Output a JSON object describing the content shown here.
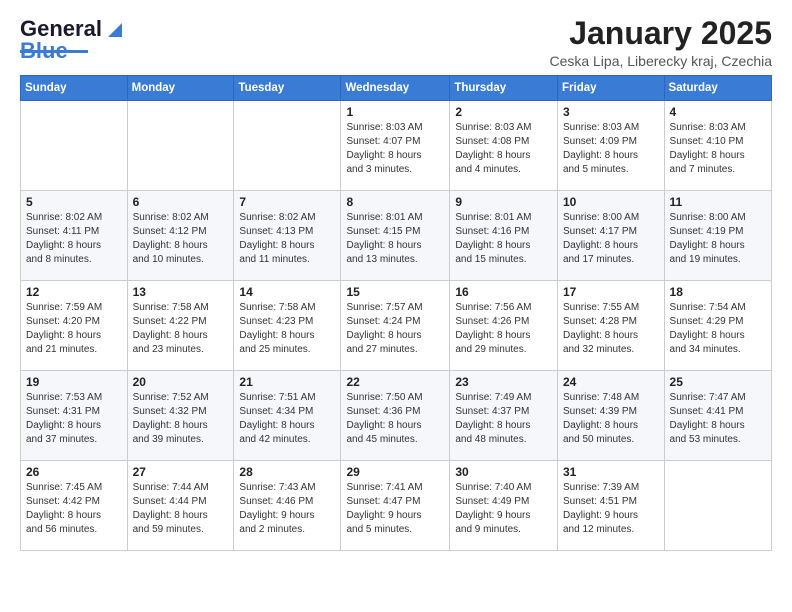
{
  "logo": {
    "text_general": "General",
    "text_blue": "Blue"
  },
  "header": {
    "title": "January 2025",
    "location": "Ceska Lipa, Liberecky kraj, Czechia"
  },
  "weekdays": [
    "Sunday",
    "Monday",
    "Tuesday",
    "Wednesday",
    "Thursday",
    "Friday",
    "Saturday"
  ],
  "weeks": [
    [
      {
        "day": "",
        "info": ""
      },
      {
        "day": "",
        "info": ""
      },
      {
        "day": "",
        "info": ""
      },
      {
        "day": "1",
        "info": "Sunrise: 8:03 AM\nSunset: 4:07 PM\nDaylight: 8 hours\nand 3 minutes."
      },
      {
        "day": "2",
        "info": "Sunrise: 8:03 AM\nSunset: 4:08 PM\nDaylight: 8 hours\nand 4 minutes."
      },
      {
        "day": "3",
        "info": "Sunrise: 8:03 AM\nSunset: 4:09 PM\nDaylight: 8 hours\nand 5 minutes."
      },
      {
        "day": "4",
        "info": "Sunrise: 8:03 AM\nSunset: 4:10 PM\nDaylight: 8 hours\nand 7 minutes."
      }
    ],
    [
      {
        "day": "5",
        "info": "Sunrise: 8:02 AM\nSunset: 4:11 PM\nDaylight: 8 hours\nand 8 minutes."
      },
      {
        "day": "6",
        "info": "Sunrise: 8:02 AM\nSunset: 4:12 PM\nDaylight: 8 hours\nand 10 minutes."
      },
      {
        "day": "7",
        "info": "Sunrise: 8:02 AM\nSunset: 4:13 PM\nDaylight: 8 hours\nand 11 minutes."
      },
      {
        "day": "8",
        "info": "Sunrise: 8:01 AM\nSunset: 4:15 PM\nDaylight: 8 hours\nand 13 minutes."
      },
      {
        "day": "9",
        "info": "Sunrise: 8:01 AM\nSunset: 4:16 PM\nDaylight: 8 hours\nand 15 minutes."
      },
      {
        "day": "10",
        "info": "Sunrise: 8:00 AM\nSunset: 4:17 PM\nDaylight: 8 hours\nand 17 minutes."
      },
      {
        "day": "11",
        "info": "Sunrise: 8:00 AM\nSunset: 4:19 PM\nDaylight: 8 hours\nand 19 minutes."
      }
    ],
    [
      {
        "day": "12",
        "info": "Sunrise: 7:59 AM\nSunset: 4:20 PM\nDaylight: 8 hours\nand 21 minutes."
      },
      {
        "day": "13",
        "info": "Sunrise: 7:58 AM\nSunset: 4:22 PM\nDaylight: 8 hours\nand 23 minutes."
      },
      {
        "day": "14",
        "info": "Sunrise: 7:58 AM\nSunset: 4:23 PM\nDaylight: 8 hours\nand 25 minutes."
      },
      {
        "day": "15",
        "info": "Sunrise: 7:57 AM\nSunset: 4:24 PM\nDaylight: 8 hours\nand 27 minutes."
      },
      {
        "day": "16",
        "info": "Sunrise: 7:56 AM\nSunset: 4:26 PM\nDaylight: 8 hours\nand 29 minutes."
      },
      {
        "day": "17",
        "info": "Sunrise: 7:55 AM\nSunset: 4:28 PM\nDaylight: 8 hours\nand 32 minutes."
      },
      {
        "day": "18",
        "info": "Sunrise: 7:54 AM\nSunset: 4:29 PM\nDaylight: 8 hours\nand 34 minutes."
      }
    ],
    [
      {
        "day": "19",
        "info": "Sunrise: 7:53 AM\nSunset: 4:31 PM\nDaylight: 8 hours\nand 37 minutes."
      },
      {
        "day": "20",
        "info": "Sunrise: 7:52 AM\nSunset: 4:32 PM\nDaylight: 8 hours\nand 39 minutes."
      },
      {
        "day": "21",
        "info": "Sunrise: 7:51 AM\nSunset: 4:34 PM\nDaylight: 8 hours\nand 42 minutes."
      },
      {
        "day": "22",
        "info": "Sunrise: 7:50 AM\nSunset: 4:36 PM\nDaylight: 8 hours\nand 45 minutes."
      },
      {
        "day": "23",
        "info": "Sunrise: 7:49 AM\nSunset: 4:37 PM\nDaylight: 8 hours\nand 48 minutes."
      },
      {
        "day": "24",
        "info": "Sunrise: 7:48 AM\nSunset: 4:39 PM\nDaylight: 8 hours\nand 50 minutes."
      },
      {
        "day": "25",
        "info": "Sunrise: 7:47 AM\nSunset: 4:41 PM\nDaylight: 8 hours\nand 53 minutes."
      }
    ],
    [
      {
        "day": "26",
        "info": "Sunrise: 7:45 AM\nSunset: 4:42 PM\nDaylight: 8 hours\nand 56 minutes."
      },
      {
        "day": "27",
        "info": "Sunrise: 7:44 AM\nSunset: 4:44 PM\nDaylight: 8 hours\nand 59 minutes."
      },
      {
        "day": "28",
        "info": "Sunrise: 7:43 AM\nSunset: 4:46 PM\nDaylight: 9 hours\nand 2 minutes."
      },
      {
        "day": "29",
        "info": "Sunrise: 7:41 AM\nSunset: 4:47 PM\nDaylight: 9 hours\nand 5 minutes."
      },
      {
        "day": "30",
        "info": "Sunrise: 7:40 AM\nSunset: 4:49 PM\nDaylight: 9 hours\nand 9 minutes."
      },
      {
        "day": "31",
        "info": "Sunrise: 7:39 AM\nSunset: 4:51 PM\nDaylight: 9 hours\nand 12 minutes."
      },
      {
        "day": "",
        "info": ""
      }
    ]
  ]
}
